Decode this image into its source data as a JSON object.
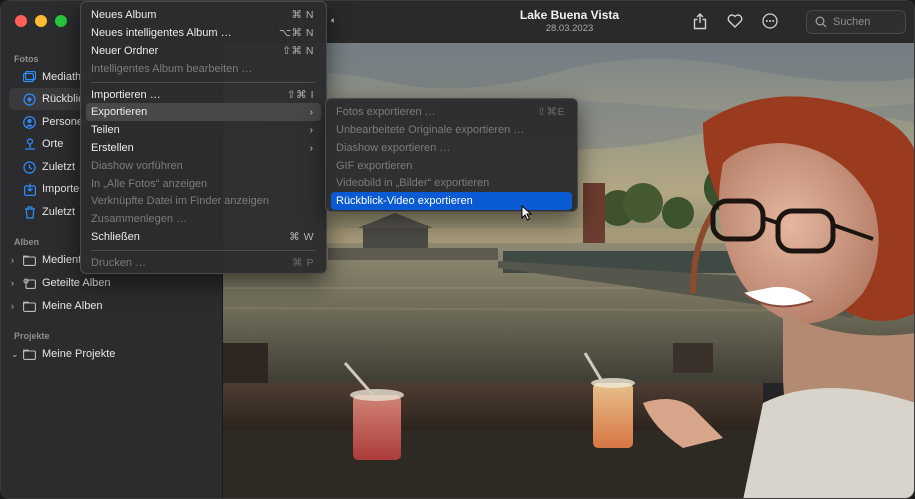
{
  "window": {
    "title": "Lake Buena Vista",
    "date": "28.03.2023"
  },
  "search": {
    "placeholder": "Suchen"
  },
  "sidebar": {
    "fotos_header": "Fotos",
    "fotos_items": [
      {
        "label": "Mediathek",
        "icon": "photos-library-icon"
      },
      {
        "label": "Rückblicke",
        "icon": "memories-icon"
      },
      {
        "label": "Personen",
        "icon": "people-icon"
      },
      {
        "label": "Orte",
        "icon": "places-icon"
      },
      {
        "label": "Zuletzt",
        "icon": "recent-icon"
      },
      {
        "label": "Importe",
        "icon": "imports-icon"
      },
      {
        "label": "Zuletzt",
        "icon": "recently-deleted-icon"
      }
    ],
    "alben_header": "Alben",
    "alben_items": [
      {
        "label": "Medientypen"
      },
      {
        "label": "Geteilte Alben"
      },
      {
        "label": "Meine Alben"
      }
    ],
    "projekte_header": "Projekte",
    "projekte_items": [
      {
        "label": "Meine Projekte"
      }
    ]
  },
  "file_menu": {
    "items": [
      {
        "label": "Neues Album",
        "shortcut": "⌘ N",
        "enabled": true
      },
      {
        "label": "Neues intelligentes Album …",
        "shortcut": "⌥⌘ N",
        "enabled": true
      },
      {
        "label": "Neuer Ordner",
        "shortcut": "⇧⌘ N",
        "enabled": true
      },
      {
        "label": "Intelligentes Album bearbeiten …",
        "shortcut": "",
        "enabled": false
      },
      {
        "label": "Importieren …",
        "shortcut": "⇧⌘ I",
        "enabled": true
      },
      {
        "label": "Exportieren",
        "shortcut": "",
        "enabled": true,
        "submenu": true
      },
      {
        "label": "Teilen",
        "shortcut": "",
        "enabled": true,
        "submenu": true
      },
      {
        "label": "Erstellen",
        "shortcut": "",
        "enabled": true,
        "submenu": true
      },
      {
        "label": "Diashow vorführen",
        "shortcut": "",
        "enabled": false
      },
      {
        "label": "In „Alle Fotos“ anzeigen",
        "shortcut": "",
        "enabled": false
      },
      {
        "label": "Verknüpfte Datei im Finder anzeigen",
        "shortcut": "",
        "enabled": false
      },
      {
        "label": "Zusammenlegen …",
        "shortcut": "",
        "enabled": false
      },
      {
        "label": "Schließen",
        "shortcut": "⌘ W",
        "enabled": true
      },
      {
        "label": "Drucken …",
        "shortcut": "⌘ P",
        "enabled": false
      }
    ]
  },
  "export_submenu": {
    "items": [
      {
        "label": "Fotos exportieren …",
        "shortcut": "⇧⌘E",
        "enabled": false
      },
      {
        "label": "Unbearbeitete Originale exportieren …",
        "shortcut": "",
        "enabled": false
      },
      {
        "label": "Diashow exportieren …",
        "shortcut": "",
        "enabled": false
      },
      {
        "label": "GIF exportieren",
        "shortcut": "",
        "enabled": false
      },
      {
        "label": "Videobild in „Bilder“ exportieren",
        "shortcut": "",
        "enabled": false
      },
      {
        "label": "Rückblick-Video exportieren",
        "shortcut": "",
        "enabled": true,
        "highlighted": true
      }
    ]
  },
  "colors": {
    "accent": "#0a5bd3",
    "close": "#ff5f57",
    "minimize": "#febc2e",
    "zoom": "#28c840"
  }
}
